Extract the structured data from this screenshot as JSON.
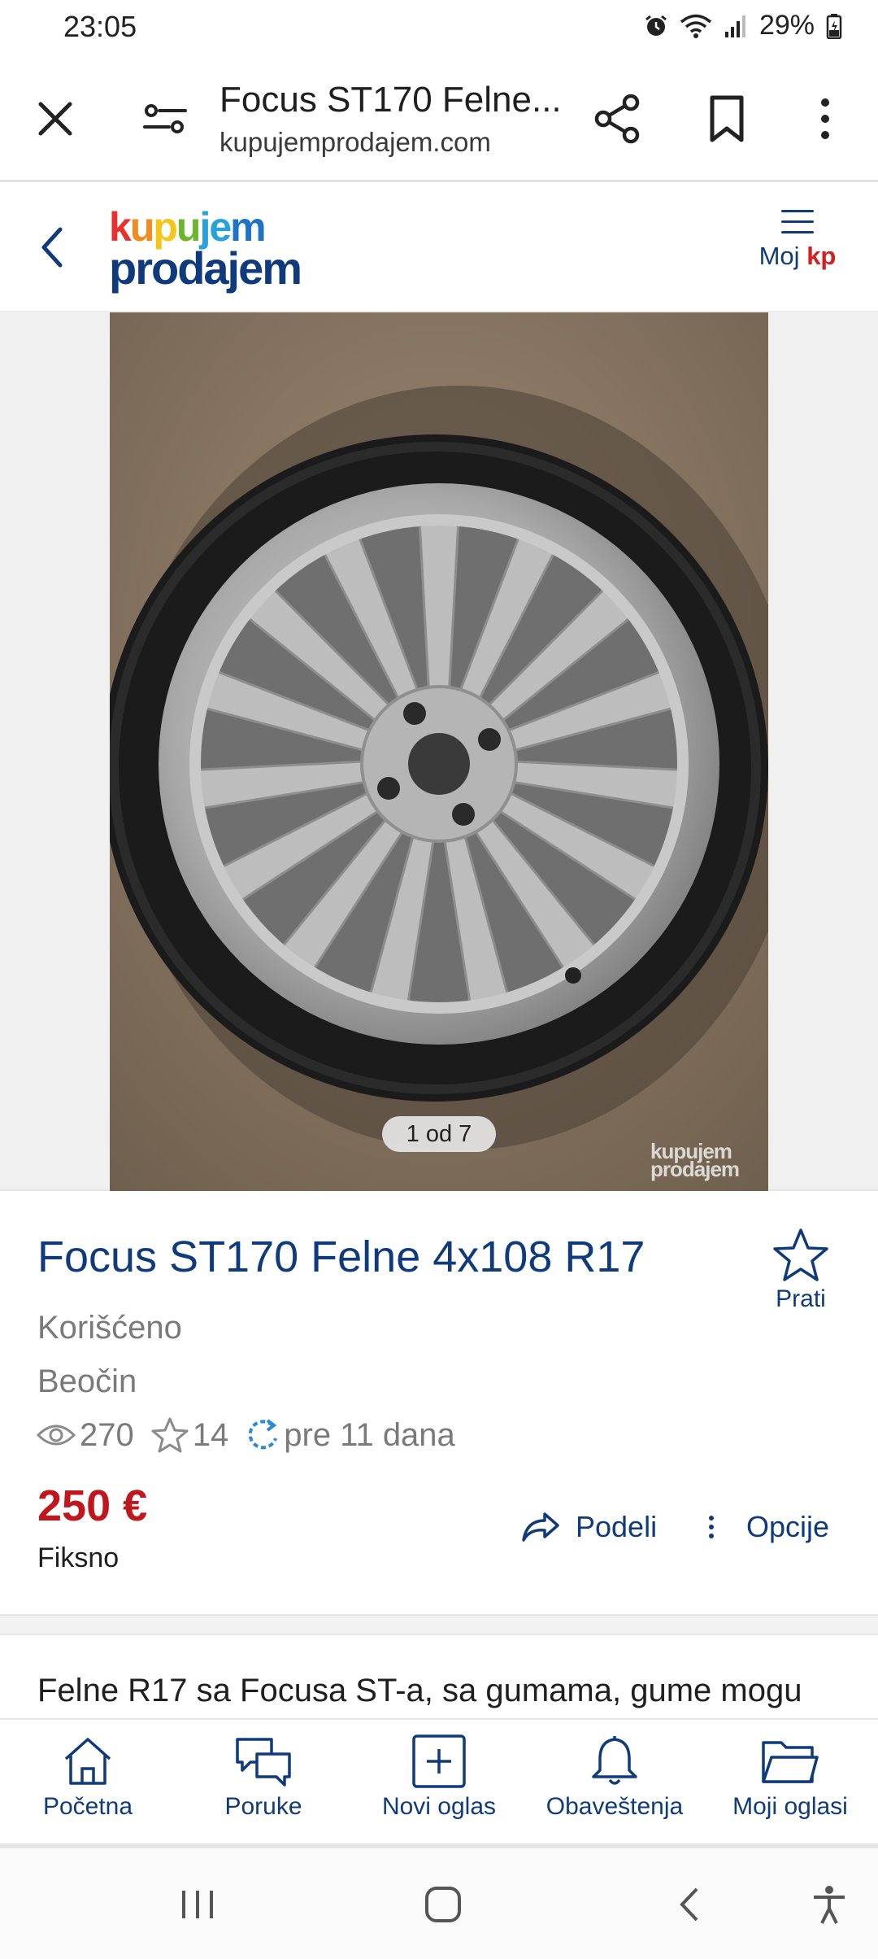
{
  "status_bar": {
    "time": "23:05",
    "battery": "29%"
  },
  "browser": {
    "title": "Focus ST170 Felne...",
    "url": "kupujemprodajem.com"
  },
  "site": {
    "logo_line1": "kupujem",
    "logo_line2": "prodajem",
    "menu_label_prefix": "Moj ",
    "menu_label_brand": "kp"
  },
  "gallery": {
    "counter": "1 od 7",
    "watermark_1": "kupujem",
    "watermark_2": "prodajem"
  },
  "listing": {
    "title": "Focus ST170 Felne 4x108 R17",
    "follow_label": "Prati",
    "condition": "Korišćeno",
    "location": "Beočin",
    "views": "270",
    "favorites": "14",
    "posted": "pre 11 dana",
    "price": "250 €",
    "price_type": "Fiksno",
    "share_label": "Podeli",
    "options_label": "Opcije",
    "description_preview": "Felne R17 sa Focusa ST-a, sa gumama, gume mogu"
  },
  "bottom_nav": [
    {
      "label": "Početna",
      "icon": "home-icon"
    },
    {
      "label": "Poruke",
      "icon": "messages-icon"
    },
    {
      "label": "Novi oglas",
      "icon": "add-ad-icon"
    },
    {
      "label": "Obaveštenja",
      "icon": "bell-icon"
    },
    {
      "label": "Moji oglasi",
      "icon": "folder-icon"
    }
  ],
  "colors": {
    "brand_blue": "#0f3b7d",
    "price_red": "#c0161d",
    "kp_red": "#d31f1f"
  }
}
